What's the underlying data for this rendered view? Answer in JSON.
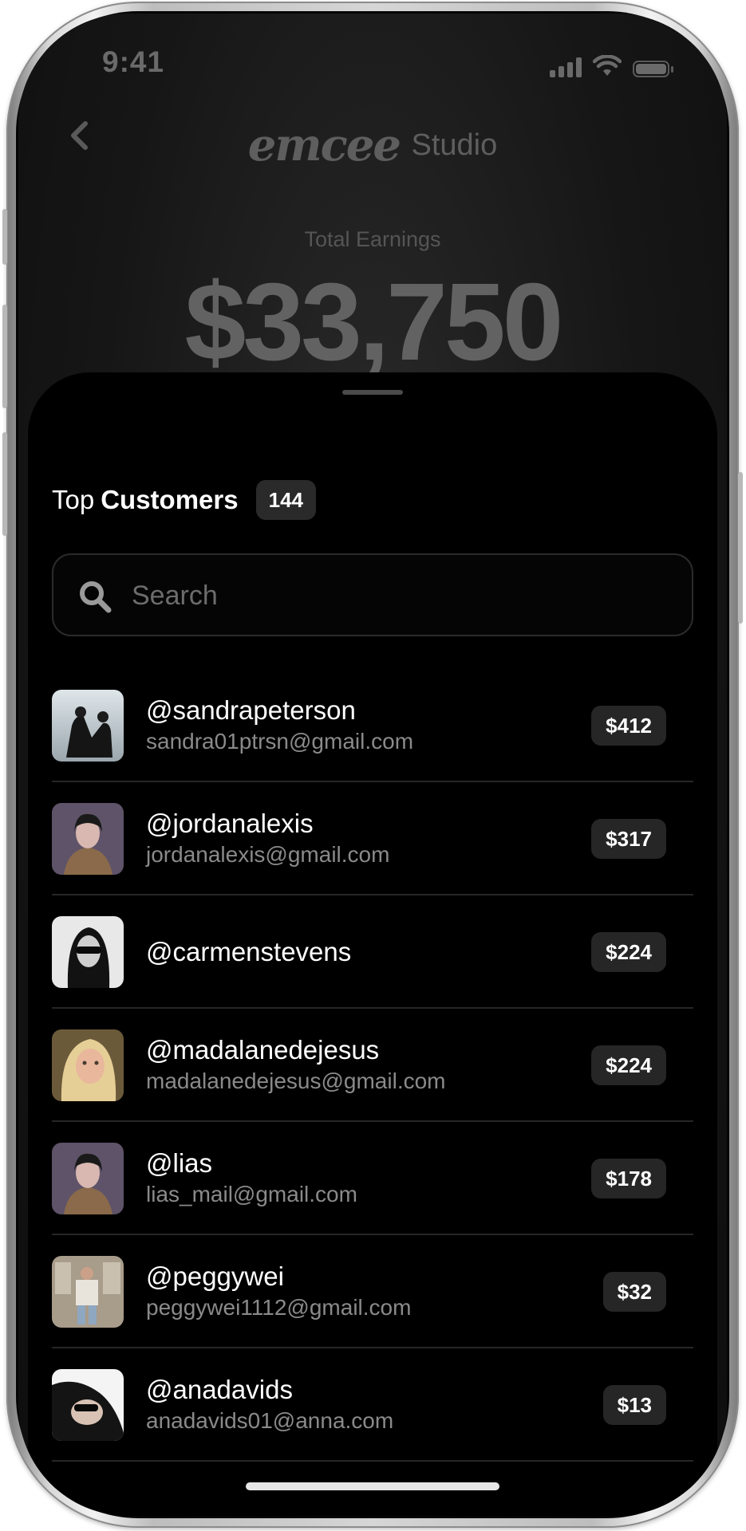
{
  "status": {
    "time": "9:41"
  },
  "header": {
    "logo_word": "emcee",
    "logo_suffix": "Studio"
  },
  "earnings": {
    "label": "Total Earnings",
    "amount": "$33,750"
  },
  "sheet": {
    "title_prefix": "Top",
    "title_main": "Customers",
    "count": "144",
    "search_placeholder": "Search"
  },
  "customers": [
    {
      "handle": "@sandrapeterson",
      "email": "sandra01ptrsn@gmail.com",
      "amount": "$412",
      "avatar": "avatar-sandra"
    },
    {
      "handle": "@jordanalexis",
      "email": "jordanalexis@gmail.com",
      "amount": "$317",
      "avatar": "avatar-jordan"
    },
    {
      "handle": "@carmenstevens",
      "email": "",
      "amount": "$224",
      "avatar": "avatar-carmen"
    },
    {
      "handle": "@madalanedejesus",
      "email": "madalanedejesus@gmail.com",
      "amount": "$224",
      "avatar": "avatar-madalane"
    },
    {
      "handle": "@lias",
      "email": "lias_mail@gmail.com",
      "amount": "$178",
      "avatar": "avatar-lias"
    },
    {
      "handle": "@peggywei",
      "email": "peggywei1112@gmail.com",
      "amount": "$32",
      "avatar": "avatar-peggy"
    },
    {
      "handle": "@anadavids",
      "email": "anadavids01@anna.com",
      "amount": "$13",
      "avatar": "avatar-ana"
    }
  ],
  "colors": {
    "sheet": "#000000",
    "badge": "#262626",
    "muted_text": "#8a8a8a",
    "divider": "#262626"
  }
}
